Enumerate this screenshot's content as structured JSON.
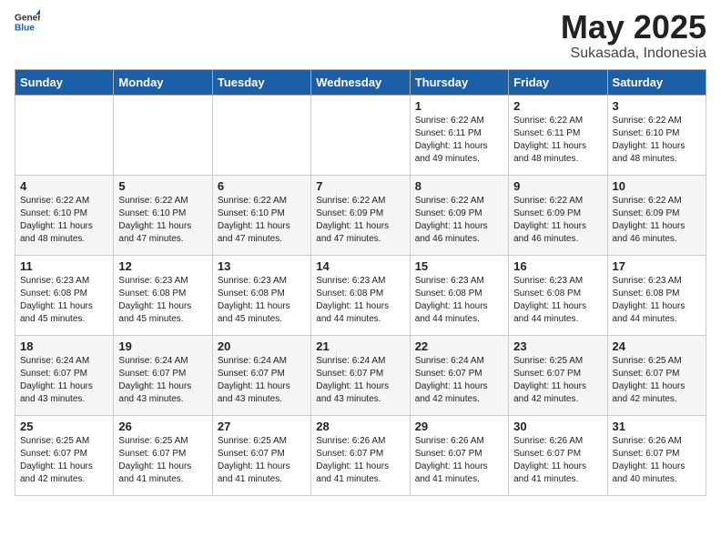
{
  "header": {
    "logo_general": "General",
    "logo_blue": "Blue",
    "month_year": "May 2025",
    "location": "Sukasada, Indonesia"
  },
  "weekdays": [
    "Sunday",
    "Monday",
    "Tuesday",
    "Wednesday",
    "Thursday",
    "Friday",
    "Saturday"
  ],
  "weeks": [
    [
      {
        "day": "",
        "info": ""
      },
      {
        "day": "",
        "info": ""
      },
      {
        "day": "",
        "info": ""
      },
      {
        "day": "",
        "info": ""
      },
      {
        "day": "1",
        "info": "Sunrise: 6:22 AM\nSunset: 6:11 PM\nDaylight: 11 hours\nand 49 minutes."
      },
      {
        "day": "2",
        "info": "Sunrise: 6:22 AM\nSunset: 6:11 PM\nDaylight: 11 hours\nand 48 minutes."
      },
      {
        "day": "3",
        "info": "Sunrise: 6:22 AM\nSunset: 6:10 PM\nDaylight: 11 hours\nand 48 minutes."
      }
    ],
    [
      {
        "day": "4",
        "info": "Sunrise: 6:22 AM\nSunset: 6:10 PM\nDaylight: 11 hours\nand 48 minutes."
      },
      {
        "day": "5",
        "info": "Sunrise: 6:22 AM\nSunset: 6:10 PM\nDaylight: 11 hours\nand 47 minutes."
      },
      {
        "day": "6",
        "info": "Sunrise: 6:22 AM\nSunset: 6:10 PM\nDaylight: 11 hours\nand 47 minutes."
      },
      {
        "day": "7",
        "info": "Sunrise: 6:22 AM\nSunset: 6:09 PM\nDaylight: 11 hours\nand 47 minutes."
      },
      {
        "day": "8",
        "info": "Sunrise: 6:22 AM\nSunset: 6:09 PM\nDaylight: 11 hours\nand 46 minutes."
      },
      {
        "day": "9",
        "info": "Sunrise: 6:22 AM\nSunset: 6:09 PM\nDaylight: 11 hours\nand 46 minutes."
      },
      {
        "day": "10",
        "info": "Sunrise: 6:22 AM\nSunset: 6:09 PM\nDaylight: 11 hours\nand 46 minutes."
      }
    ],
    [
      {
        "day": "11",
        "info": "Sunrise: 6:23 AM\nSunset: 6:08 PM\nDaylight: 11 hours\nand 45 minutes."
      },
      {
        "day": "12",
        "info": "Sunrise: 6:23 AM\nSunset: 6:08 PM\nDaylight: 11 hours\nand 45 minutes."
      },
      {
        "day": "13",
        "info": "Sunrise: 6:23 AM\nSunset: 6:08 PM\nDaylight: 11 hours\nand 45 minutes."
      },
      {
        "day": "14",
        "info": "Sunrise: 6:23 AM\nSunset: 6:08 PM\nDaylight: 11 hours\nand 44 minutes."
      },
      {
        "day": "15",
        "info": "Sunrise: 6:23 AM\nSunset: 6:08 PM\nDaylight: 11 hours\nand 44 minutes."
      },
      {
        "day": "16",
        "info": "Sunrise: 6:23 AM\nSunset: 6:08 PM\nDaylight: 11 hours\nand 44 minutes."
      },
      {
        "day": "17",
        "info": "Sunrise: 6:23 AM\nSunset: 6:08 PM\nDaylight: 11 hours\nand 44 minutes."
      }
    ],
    [
      {
        "day": "18",
        "info": "Sunrise: 6:24 AM\nSunset: 6:07 PM\nDaylight: 11 hours\nand 43 minutes."
      },
      {
        "day": "19",
        "info": "Sunrise: 6:24 AM\nSunset: 6:07 PM\nDaylight: 11 hours\nand 43 minutes."
      },
      {
        "day": "20",
        "info": "Sunrise: 6:24 AM\nSunset: 6:07 PM\nDaylight: 11 hours\nand 43 minutes."
      },
      {
        "day": "21",
        "info": "Sunrise: 6:24 AM\nSunset: 6:07 PM\nDaylight: 11 hours\nand 43 minutes."
      },
      {
        "day": "22",
        "info": "Sunrise: 6:24 AM\nSunset: 6:07 PM\nDaylight: 11 hours\nand 42 minutes."
      },
      {
        "day": "23",
        "info": "Sunrise: 6:25 AM\nSunset: 6:07 PM\nDaylight: 11 hours\nand 42 minutes."
      },
      {
        "day": "24",
        "info": "Sunrise: 6:25 AM\nSunset: 6:07 PM\nDaylight: 11 hours\nand 42 minutes."
      }
    ],
    [
      {
        "day": "25",
        "info": "Sunrise: 6:25 AM\nSunset: 6:07 PM\nDaylight: 11 hours\nand 42 minutes."
      },
      {
        "day": "26",
        "info": "Sunrise: 6:25 AM\nSunset: 6:07 PM\nDaylight: 11 hours\nand 41 minutes."
      },
      {
        "day": "27",
        "info": "Sunrise: 6:25 AM\nSunset: 6:07 PM\nDaylight: 11 hours\nand 41 minutes."
      },
      {
        "day": "28",
        "info": "Sunrise: 6:26 AM\nSunset: 6:07 PM\nDaylight: 11 hours\nand 41 minutes."
      },
      {
        "day": "29",
        "info": "Sunrise: 6:26 AM\nSunset: 6:07 PM\nDaylight: 11 hours\nand 41 minutes."
      },
      {
        "day": "30",
        "info": "Sunrise: 6:26 AM\nSunset: 6:07 PM\nDaylight: 11 hours\nand 41 minutes."
      },
      {
        "day": "31",
        "info": "Sunrise: 6:26 AM\nSunset: 6:07 PM\nDaylight: 11 hours\nand 40 minutes."
      }
    ]
  ]
}
